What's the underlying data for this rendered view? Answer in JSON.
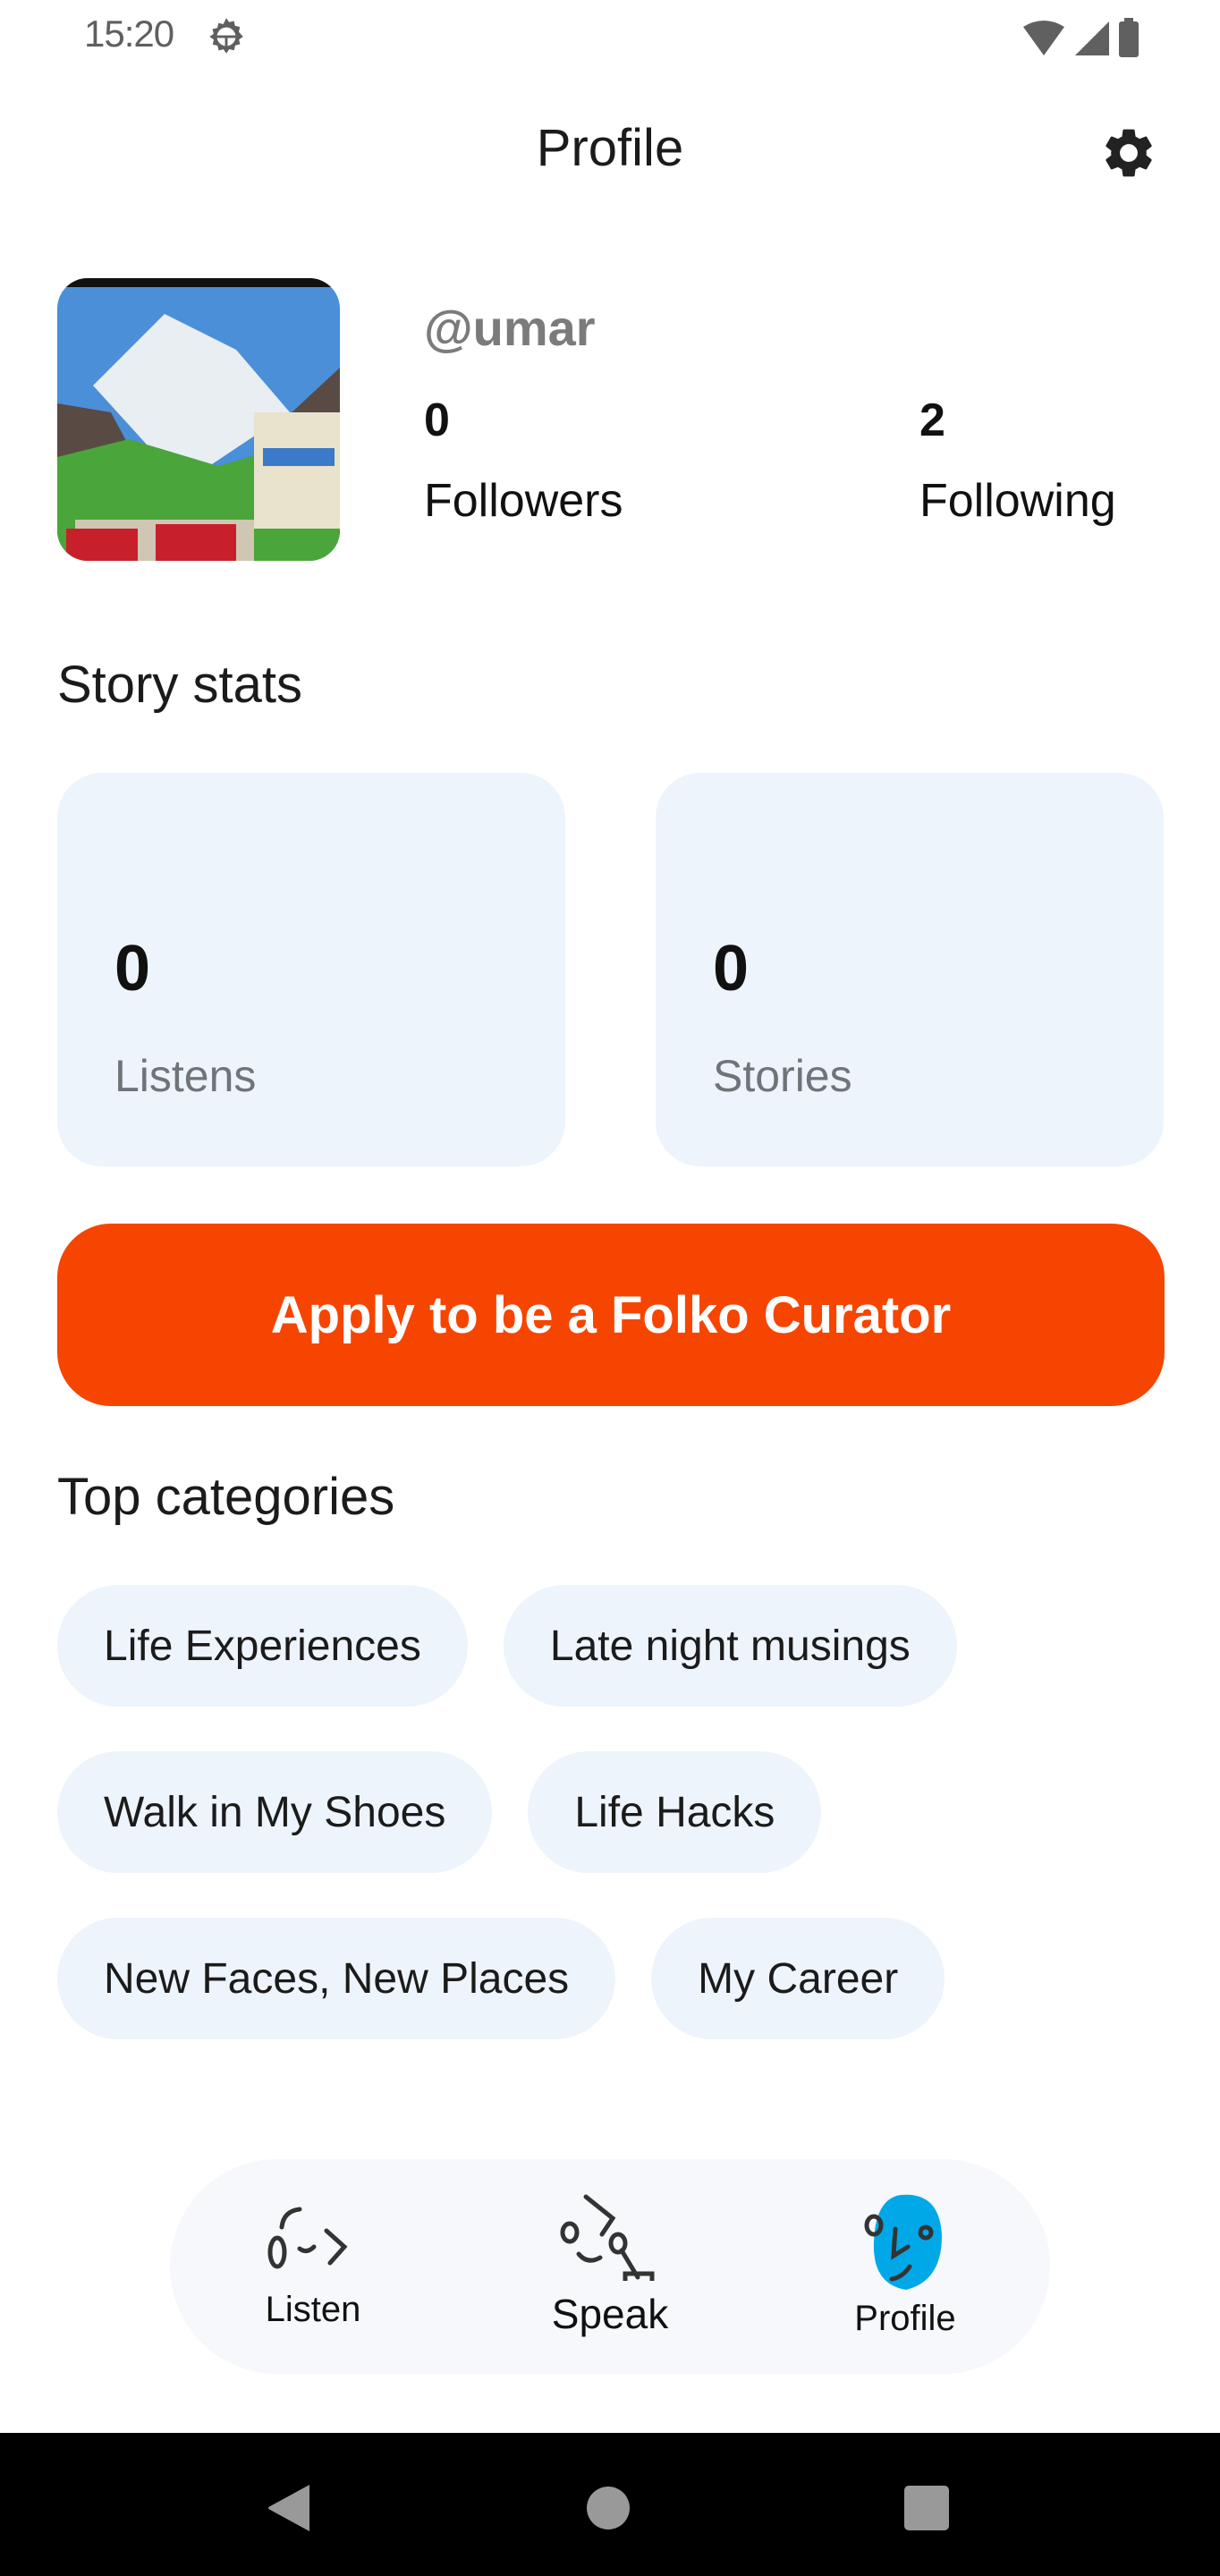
{
  "status_bar": {
    "time": "15:20",
    "icons": [
      "settings-gear-icon",
      "wifi-icon",
      "cellular-signal-icon",
      "battery-icon"
    ]
  },
  "header": {
    "title": "Profile",
    "settings_icon": "gear-icon"
  },
  "profile": {
    "username": "@umar",
    "avatar_description": "mountain valley photo",
    "followers": {
      "count": "0",
      "label": "Followers"
    },
    "following": {
      "count": "2",
      "label": "Following"
    }
  },
  "story_stats": {
    "title": "Story stats",
    "cards": [
      {
        "value": "0",
        "label": "Listens"
      },
      {
        "value": "0",
        "label": "Stories"
      }
    ]
  },
  "cta": {
    "label": "Apply to be a Folko Curator",
    "color": "#f64500"
  },
  "top_categories": {
    "title": "Top categories",
    "chips": [
      "Life Experiences",
      "Late night musings",
      "Walk in My Shoes",
      "Life Hacks",
      "New Faces, New Places",
      "My Career"
    ]
  },
  "bottom_nav": {
    "items": [
      {
        "label": "Listen",
        "icon": "listen-face-icon",
        "active": false
      },
      {
        "label": "Speak",
        "icon": "speak-face-icon",
        "active": false
      },
      {
        "label": "Profile",
        "icon": "profile-face-icon",
        "active": true
      }
    ],
    "active_color": "#00a8e8"
  },
  "system_nav": {
    "buttons": [
      "back",
      "home",
      "recents"
    ]
  }
}
